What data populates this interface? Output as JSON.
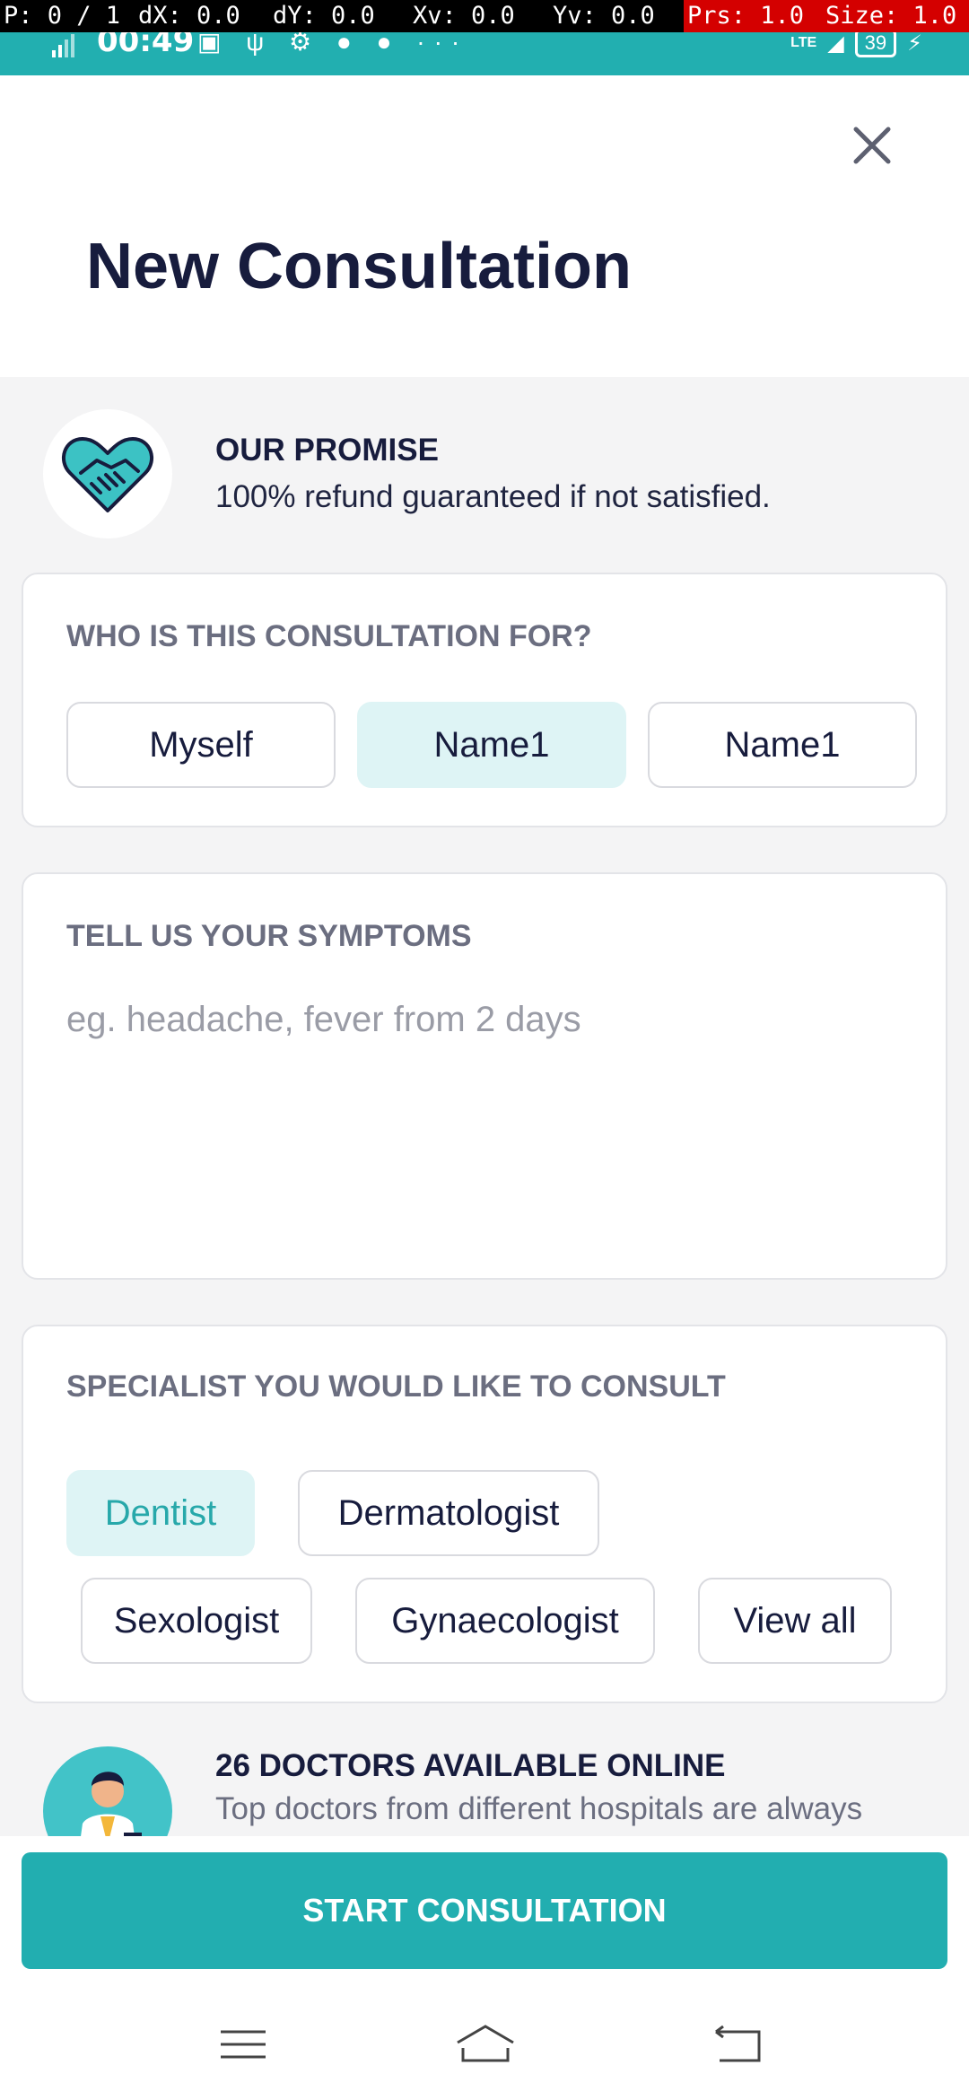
{
  "debug": {
    "pointer": "P: 0 / 1",
    "dx": "dX: 0.0",
    "dy": "dY: 0.0",
    "xv": "Xv: 0.0",
    "yv": "Yv: 0.0",
    "prs": "Prs: 1.0",
    "size": "Size: 1.0"
  },
  "status": {
    "time": "00:49",
    "network_small": "4G",
    "lte": "LTE",
    "battery": "39"
  },
  "header": {
    "title": "New Consultation",
    "close_icon": "close-icon"
  },
  "promise": {
    "title": "OUR PROMISE",
    "text": "100% refund guaranteed if not satisfied.",
    "icon": "handshake-heart-icon"
  },
  "consultation_for": {
    "label": "WHO IS THIS CONSULTATION FOR?",
    "options": [
      "Myself",
      "Name1",
      "Name1"
    ],
    "selected_index": 1
  },
  "symptoms": {
    "label": "TELL US YOUR SYMPTOMS",
    "placeholder": "eg. headache, fever from 2 days",
    "value": ""
  },
  "specialist": {
    "label": "SPECIALIST YOU WOULD LIKE TO CONSULT",
    "options": [
      "Dentist",
      "Dermatologist",
      "Sexologist",
      "Gynaecologist",
      "View all"
    ],
    "selected": "Dentist"
  },
  "doctors": {
    "title": "26 DOCTORS AVAILABLE ONLINE",
    "text": "Top doctors from different hospitals are always"
  },
  "cta": {
    "label": "START CONSULTATION"
  },
  "colors": {
    "accent": "#22aeb0",
    "accent_light": "#def4f5",
    "title": "#171c3d"
  }
}
